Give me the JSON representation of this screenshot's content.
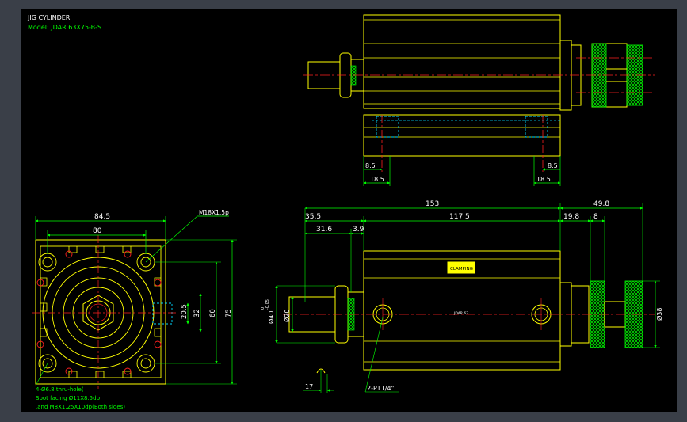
{
  "title_block": {
    "title": "JIG CYLINDER",
    "model": "Model: JDAR 63X75-B-S"
  },
  "colors": {
    "background": "#000000",
    "outline": "#ffff00",
    "dimension": "#00ff00",
    "centerline": "#ff2020",
    "hidden": "#00d8ff",
    "text": "#ffffff"
  },
  "front_view": {
    "dims": {
      "overall_width": "84.5",
      "bolt_pitch": "80",
      "thread": "M18X1.5p",
      "port_pitch": "20.5",
      "inner_height": "32",
      "bolt_height": "60",
      "overall_height": "75"
    },
    "notes": [
      "4-Ø6.8  thru-hole(",
      "Spot facing Ø11X8.5dp",
      ",and M8X1.25X10dp(Both sides)"
    ]
  },
  "top_view": {
    "dims": {
      "left_offset": "8.5",
      "left_width": "18.5",
      "right_offset": "8.5",
      "right_width": "18.5"
    }
  },
  "side_view": {
    "dims": {
      "total_length": "153",
      "extension": "49.8",
      "rod_length": "35.5",
      "body_length": "117.5",
      "knob_length": "19.8",
      "knob_gap": "8",
      "rod_to_face": "31.6",
      "face_thickness": "3.9",
      "rod_diameter": "Ø40",
      "rod_tolerance_upper": "0",
      "rod_tolerance_lower": "-0.05",
      "shaft_diameter": "Ø20",
      "knob_diameter": "Ø38",
      "bottom_offset": "17",
      "port": "2-PT1/4\""
    },
    "nameplate": "CLAMPING",
    "center_label": "JDAR 63"
  }
}
